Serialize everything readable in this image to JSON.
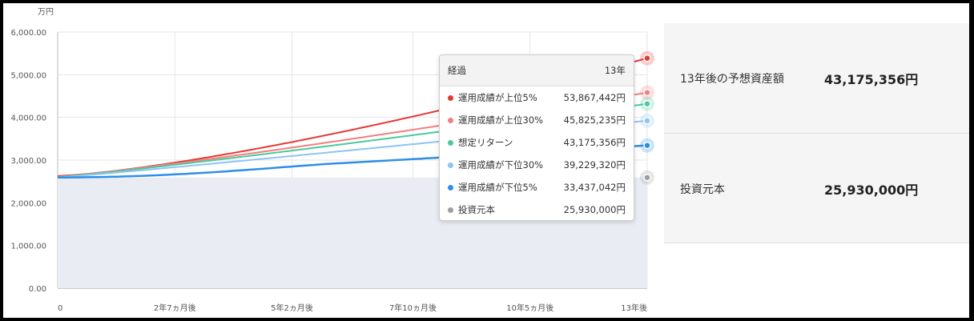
{
  "chart_data": {
    "type": "line",
    "unit_label": "万円",
    "x_range_years": [
      0,
      13
    ],
    "x_ticks": [
      {
        "t": 0,
        "label": "0"
      },
      {
        "t": 2.5833,
        "label": "2年7ヵ月後"
      },
      {
        "t": 5.1667,
        "label": "5年2ヵ月後"
      },
      {
        "t": 7.8333,
        "label": "7年10ヵ月後"
      },
      {
        "t": 10.4167,
        "label": "10年5ヵ月後"
      },
      {
        "t": 13,
        "label": "13年後"
      }
    ],
    "y_ticks": [
      "0.00",
      "1,000.00",
      "2,000.00",
      "3,000.00",
      "4,000.00",
      "5,000.00",
      "6,000.00"
    ],
    "ylim": [
      0,
      6000
    ],
    "grid": true,
    "series": [
      {
        "name": "運用成績が上位5%",
        "color": "#e53935",
        "start": 2630,
        "end": 5387,
        "curve": 1.35,
        "dip": 0
      },
      {
        "name": "運用成績が上位30%",
        "color": "#f28080",
        "start": 2610,
        "end": 4583,
        "curve": 1.15,
        "dip": 0
      },
      {
        "name": "想定リターン",
        "color": "#4cc9a0",
        "start": 2600,
        "end": 4318,
        "curve": 1.1,
        "dip": 0
      },
      {
        "name": "運用成績が下位30%",
        "color": "#8ec4f2",
        "start": 2590,
        "end": 3923,
        "curve": 1.05,
        "dip": 0
      },
      {
        "name": "運用成績が下位5%",
        "color": "#2f8fe8",
        "start": 2593,
        "end": 3344,
        "curve": 1.1,
        "dip": 70
      },
      {
        "name": "投資元本",
        "color": "#9e9e9e",
        "start": 2593,
        "end": 2593,
        "curve": 1,
        "dip": 0
      }
    ],
    "principal_area_color": "#e9edf3"
  },
  "tooltip": {
    "header_label": "経過",
    "header_value": "13年",
    "rows": [
      {
        "name": "運用成績が上位5%",
        "value": "53,867,442円",
        "color": "#e53935"
      },
      {
        "name": "運用成績が上位30%",
        "value": "45,825,235円",
        "color": "#f28080"
      },
      {
        "name": "想定リターン",
        "value": "43,175,356円",
        "color": "#4cc9a0"
      },
      {
        "name": "運用成績が下位30%",
        "value": "39,229,320円",
        "color": "#8ec4f2"
      },
      {
        "name": "運用成績が下位5%",
        "value": "33,437,042円",
        "color": "#2f8fe8"
      },
      {
        "name": "投資元本",
        "value": "25,930,000円",
        "color": "#9e9e9e"
      }
    ]
  },
  "summary": {
    "projected_label": "13年後の予想資産額",
    "projected_value": "43,175,356円",
    "principal_label": "投資元本",
    "principal_value": "25,930,000円"
  }
}
